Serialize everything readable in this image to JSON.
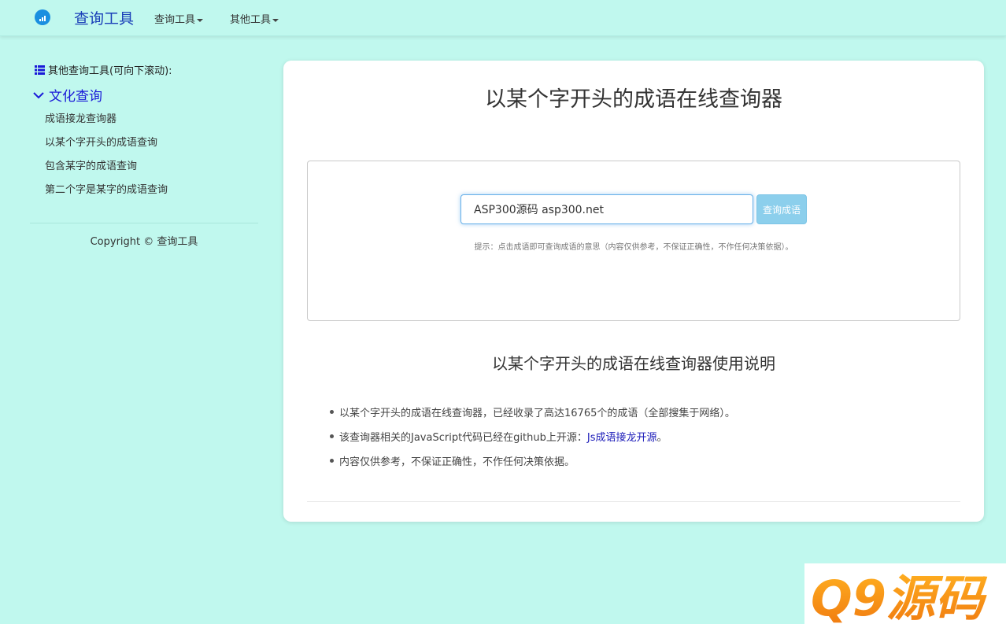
{
  "navbar": {
    "brand": "查询工具",
    "menus": [
      {
        "label": "查询工具"
      },
      {
        "label": "其他工具"
      }
    ]
  },
  "sidebar": {
    "heading": "其他查询工具(可向下滚动):",
    "category": "文化查询",
    "links": [
      {
        "label": "成语接龙查询器"
      },
      {
        "label": "以某个字开头的成语查询"
      },
      {
        "label": "包含某字的成语查询"
      },
      {
        "label": "第二个字是某字的成语查询"
      }
    ],
    "copyright": "Copyright © 查询工具"
  },
  "main": {
    "title": "以某个字开头的成语在线查询器",
    "search": {
      "value": "ASP300源码 asp300.net",
      "button_label": "查询成语"
    },
    "hint": "提示：点击成语即可查询成语的意思（内容仅供参考，不保证正确性，不作任何决策依据）。",
    "usage_title": "以某个字开头的成语在线查询器使用说明",
    "usage_items": [
      {
        "text": "以某个字开头的成语在线查询器，已经收录了高达16765个的成语（全部搜集于网络）。"
      },
      {
        "text_before": "该查询器相关的JavaScript代码已经在github上开源：",
        "link": "Js成语接龙开源",
        "text_after": "。"
      },
      {
        "text": "内容仅供参考，不保证正确性，不作任何决策依据。"
      }
    ]
  },
  "watermark": {
    "text": "Q9源码"
  },
  "colors": {
    "background": "#c0f8ee",
    "brand": "#1a3fb8",
    "category": "#1a1ad8",
    "button": "#8ccfec",
    "link": "#1a1ab8",
    "logo": "#1a8fe0"
  }
}
